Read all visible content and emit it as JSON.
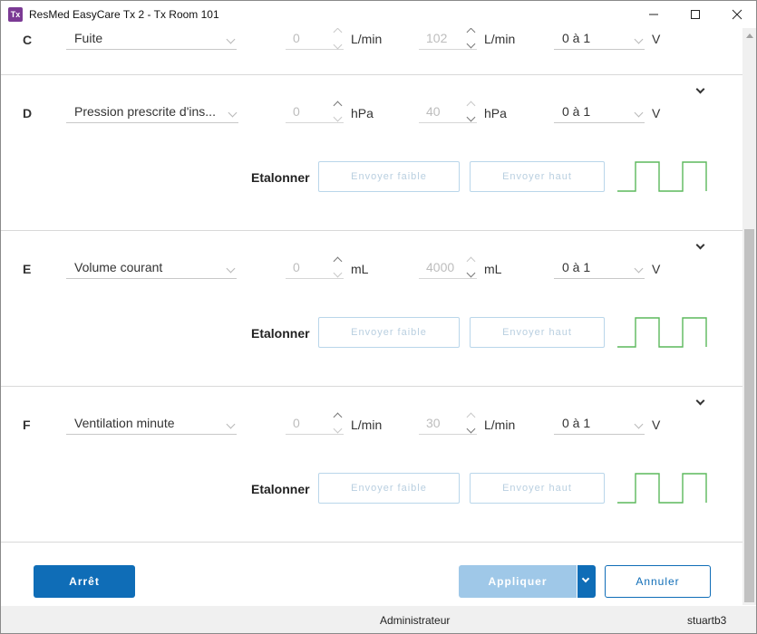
{
  "window": {
    "app_icon": "Tx",
    "title": "ResMed EasyCare Tx 2 - Tx Room 101",
    "controls": [
      "minimize-icon",
      "maximize-icon",
      "close-icon"
    ]
  },
  "channels": [
    {
      "letter": "C",
      "signal": "Fuite",
      "low_value": "0",
      "low_unit": "L/min",
      "high_value": "102",
      "high_unit": "L/min",
      "range": "0 à 1",
      "range_unit": "V",
      "expanded": false
    },
    {
      "letter": "D",
      "signal": "Pression prescrite d'ins...",
      "low_value": "0",
      "low_unit": "hPa",
      "high_value": "40",
      "high_unit": "hPa",
      "range": "0 à 1",
      "range_unit": "V",
      "expanded": true,
      "calibrate_label": "Etalonner",
      "send_low_label": "Envoyer faible",
      "send_high_label": "Envoyer haut"
    },
    {
      "letter": "E",
      "signal": "Volume courant",
      "low_value": "0",
      "low_unit": "mL",
      "high_value": "4000",
      "high_unit": "mL",
      "range": "0 à 1",
      "range_unit": "V",
      "expanded": true,
      "calibrate_label": "Etalonner",
      "send_low_label": "Envoyer faible",
      "send_high_label": "Envoyer haut"
    },
    {
      "letter": "F",
      "signal": "Ventilation minute",
      "low_value": "0",
      "low_unit": "L/min",
      "high_value": "30",
      "high_unit": "L/min",
      "range": "0 à 1",
      "range_unit": "V",
      "expanded": true,
      "calibrate_label": "Etalonner",
      "send_low_label": "Envoyer faible",
      "send_high_label": "Envoyer haut"
    }
  ],
  "footer": {
    "stop_label": "Arrêt",
    "apply_label": "Appliquer",
    "cancel_label": "Annuler"
  },
  "status": {
    "role": "Administrateur",
    "user": "stuartb3"
  },
  "colors": {
    "primary": "#0f6db7",
    "primary_disabled": "#9fc8e8",
    "wave": "#5cb85c",
    "app_icon": "#7b3a94"
  }
}
